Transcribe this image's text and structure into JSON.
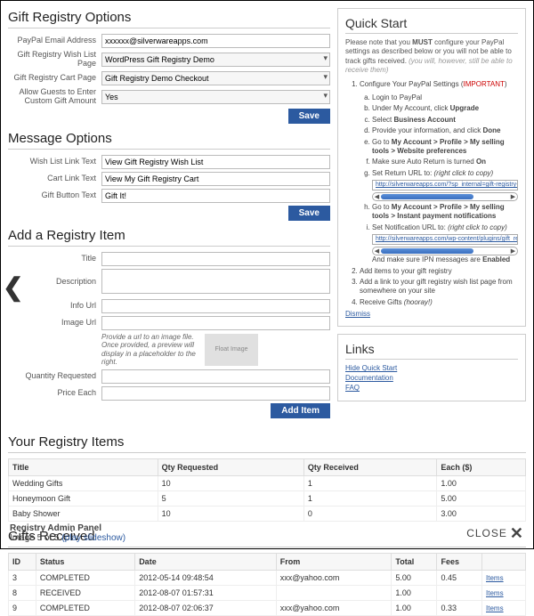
{
  "sections": {
    "gift_options": "Gift Registry Options",
    "message_options": "Message Options",
    "add_item": "Add a Registry Item",
    "your_items": "Your Registry Items",
    "gifts_received": "Gifts Received"
  },
  "gift_opts": {
    "paypal_email_lbl": "PayPal Email Address",
    "paypal_email_val": "xxxxxx@silverwareapps.com",
    "wishlist_page_lbl": "Gift Registry Wish List Page",
    "wishlist_page_val": "WordPress Gift Registry Demo",
    "cart_page_lbl": "Gift Registry Cart Page",
    "cart_page_val": "Gift Registry Demo Checkout",
    "allow_guests_lbl": "Allow Guests to Enter Custom Gift Amount",
    "allow_guests_val": "Yes"
  },
  "msg_opts": {
    "wishlist_link_lbl": "Wish List Link Text",
    "wishlist_link_val": "View Gift Registry Wish List",
    "cart_link_lbl": "Cart Link Text",
    "cart_link_val": "View My Gift Registry Cart",
    "gift_btn_lbl": "Gift Button Text",
    "gift_btn_val": "Gift It!"
  },
  "add_item": {
    "title_lbl": "Title",
    "desc_lbl": "Description",
    "info_url_lbl": "Info Url",
    "image_url_lbl": "Image Url",
    "img_note": "Provide a url to an image file. Once provided, a preview will display in a placeholder to the right.",
    "img_placeholder": "Float Image",
    "qty_req_lbl": "Quantity Requested",
    "price_each_lbl": "Price Each",
    "add_btn": "Add Item"
  },
  "save_btn": "Save",
  "quick_start": {
    "heading": "Quick Start",
    "intro_a": "Please note that you ",
    "intro_must": "MUST",
    "intro_b": " configure your PayPal settings as described below or you will not be able to track gifts received. ",
    "intro_i": "(you will, however, still be able to receive them)",
    "s1": "Configure Your PayPal Settings (",
    "s1_imp": "IMPORTANT",
    "s1_end": ")",
    "a": "Login to PayPal",
    "b_a": "Under My Account, click ",
    "b_b": "Upgrade",
    "c_a": "Select ",
    "c_b": "Business Account",
    "d_a": "Provide your information, and click ",
    "d_b": "Done",
    "e_a": "Go to ",
    "e_b": "My Account > Profile > My selling tools > Website preferences",
    "f_a": "Make sure Auto Return is turned ",
    "f_b": "On",
    "g_a": "Set Return URL to: ",
    "g_i": "(right click to copy)",
    "g_url": "http://silverwareapps.com/?sp_internal=gift-registry-transaction-com",
    "h_a": "Go to ",
    "h_b": "My Account > Profile > My selling tools > Instant payment notifications",
    "i_a": "Set Notification URL to: ",
    "i_i": "(right click to copy)",
    "i_url": "http://silverwareapps.com/wp-content/plugins/gift_registry/php/ipn_l",
    "j_a": "And make sure IPN messages are ",
    "j_b": "Enabled",
    "s2": "Add items to your gift registry",
    "s3": "Add a link to your gift registry wish list page from somewhere on your site",
    "s4_a": "Receive Gifts ",
    "s4_i": "(hooray!)",
    "dismiss": "Dismiss"
  },
  "links_box": {
    "heading": "Links",
    "l1": "Hide Quick Start",
    "l2": "Documentation",
    "l3": "FAQ"
  },
  "items_table": {
    "h1": "Title",
    "h2": "Qty Requested",
    "h3": "Qty Received",
    "h4": "Each ($)",
    "rows": [
      {
        "t": "Wedding Gifts",
        "qr": "10",
        "qrec": "1",
        "e": "1.00"
      },
      {
        "t": "Honeymoon Gift",
        "qr": "5",
        "qrec": "1",
        "e": "5.00"
      },
      {
        "t": "Baby Shower",
        "qr": "10",
        "qrec": "0",
        "e": "3.00"
      }
    ]
  },
  "gifts_table": {
    "h1": "ID",
    "h2": "Status",
    "h3": "Date",
    "h4": "From",
    "h5": "Total",
    "h6": "Fees",
    "h7": "",
    "rows": [
      {
        "id": "3",
        "st": "COMPLETED",
        "dt": "2012-05-14 09:48:54",
        "fr": "xxx@yahoo.com",
        "tot": "5.00",
        "fee": "0.45",
        "it": "Items"
      },
      {
        "id": "8",
        "st": "RECEIVED",
        "dt": "2012-08-07 01:57:31",
        "fr": "",
        "tot": "1.00",
        "fee": "",
        "it": "Items"
      },
      {
        "id": "9",
        "st": "COMPLETED",
        "dt": "2012-08-07 02:06:37",
        "fr": "xxx@yahoo.com",
        "tot": "1.00",
        "fee": "0.33",
        "it": "Items"
      }
    ]
  },
  "footer": {
    "title": "Registry Admin Panel",
    "caption_a": "Image 5 of 5 ",
    "slideshow": "(play slideshow)",
    "close": "CLOSE"
  }
}
